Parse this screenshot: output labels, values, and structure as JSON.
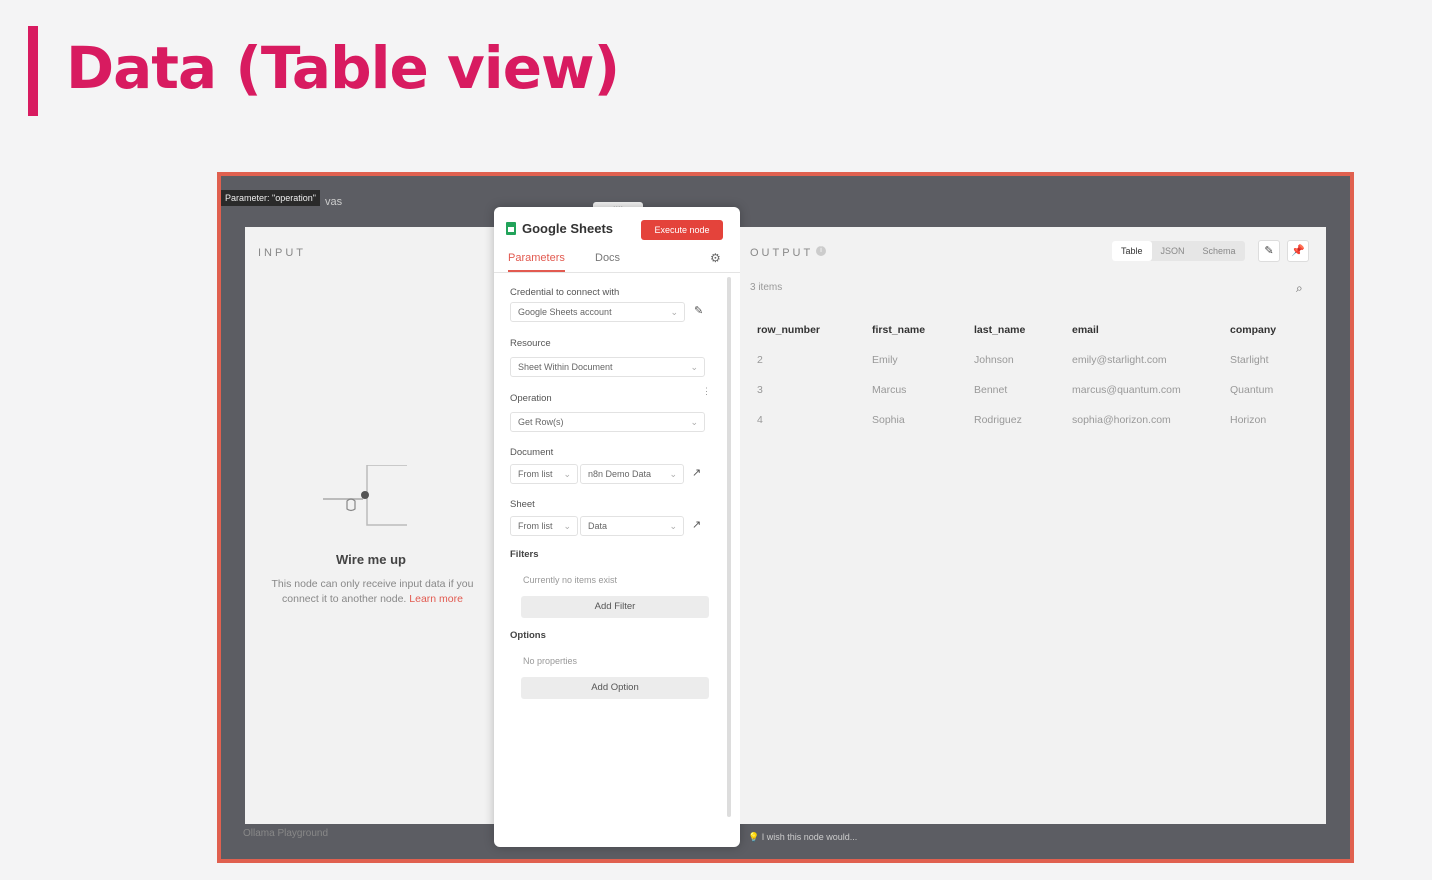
{
  "slide": {
    "title": "Data (Table view)"
  },
  "canvas": {
    "tooltip": "Parameter: \"operation\"",
    "label": "vas",
    "handle": "::::",
    "footer": "Ollama Playground",
    "hint": "I wish this node would..."
  },
  "input": {
    "caption": "INPUT",
    "wire_title": "Wire me up",
    "wire_text": "This node can only receive input data if you connect it to another node.",
    "learn_more": "Learn more"
  },
  "node": {
    "title": "Google Sheets",
    "execute_label": "Execute node",
    "tabs": [
      "Parameters",
      "Docs"
    ],
    "credential_label": "Credential to connect with",
    "credential_value": "Google Sheets account",
    "resource_label": "Resource",
    "resource_value": "Sheet Within Document",
    "operation_label": "Operation",
    "operation_value": "Get Row(s)",
    "document_label": "Document",
    "document_mode": "From list",
    "document_value": "n8n Demo Data",
    "sheet_label": "Sheet",
    "sheet_mode": "From list",
    "sheet_value": "Data",
    "filters_label": "Filters",
    "filters_empty": "Currently no items exist",
    "add_filter": "Add Filter",
    "options_label": "Options",
    "options_empty": "No properties",
    "add_option": "Add Option"
  },
  "output": {
    "caption": "OUTPUT",
    "view_options": [
      "Table",
      "JSON",
      "Schema"
    ],
    "items_count": "3 items",
    "columns": [
      "row_number",
      "first_name",
      "last_name",
      "email",
      "company"
    ],
    "rows": [
      [
        "2",
        "Emily",
        "Johnson",
        "emily@starlight.com",
        "Starlight"
      ],
      [
        "3",
        "Marcus",
        "Bennet",
        "marcus@quantum.com",
        "Quantum"
      ],
      [
        "4",
        "Sophia",
        "Rodriguez",
        "sophia@horizon.com",
        "Horizon"
      ]
    ]
  },
  "colors": {
    "accent": "#d81b60",
    "frame": "#e0604f",
    "execute": "#e4433b",
    "sheets_green": "#22a35a"
  }
}
